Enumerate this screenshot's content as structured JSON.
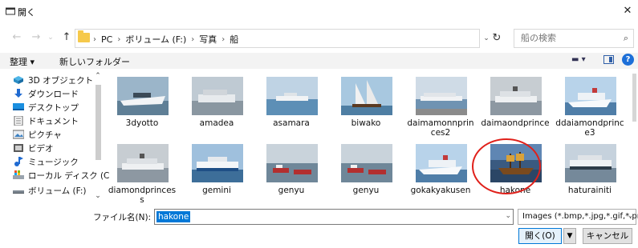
{
  "window": {
    "title": "開く"
  },
  "address": {
    "crumbs": [
      "PC",
      "ボリューム (F:)",
      "写真",
      "船"
    ]
  },
  "search": {
    "placeholder": "船の検索"
  },
  "commands": {
    "organize": "整理 ▾",
    "new_folder": "新しいフォルダー"
  },
  "nav": {
    "items": [
      {
        "label": "3D オブジェクト",
        "icon": "3d-objects-icon"
      },
      {
        "label": "ダウンロード",
        "icon": "download-icon"
      },
      {
        "label": "デスクトップ",
        "icon": "desktop-icon"
      },
      {
        "label": "ドキュメント",
        "icon": "document-icon"
      },
      {
        "label": "ピクチャ",
        "icon": "pictures-icon"
      },
      {
        "label": "ビデオ",
        "icon": "video-icon"
      },
      {
        "label": "ミュージック",
        "icon": "music-icon"
      },
      {
        "label": "ローカル ディスク (C",
        "icon": "local-disk-icon"
      },
      {
        "label": "ボリューム (F:)",
        "icon": "drive-icon"
      }
    ]
  },
  "files": [
    {
      "name": "3dyotto",
      "theme": "yacht"
    },
    {
      "name": "amadea",
      "theme": "harbor"
    },
    {
      "name": "asamara",
      "theme": "sea"
    },
    {
      "name": "biwako",
      "theme": "sailship"
    },
    {
      "name": "daimamonnprinces2",
      "theme": "port"
    },
    {
      "name": "daimaondprince",
      "theme": "liner-gray"
    },
    {
      "name": "ddaiamondprince3",
      "theme": "liner-white"
    },
    {
      "name": "diamondprincess",
      "theme": "liner-gray"
    },
    {
      "name": "gemini",
      "theme": "liner-blue"
    },
    {
      "name": "genyu",
      "theme": "tugs"
    },
    {
      "name": "genyu",
      "theme": "tugs"
    },
    {
      "name": "gokakyakusen",
      "theme": "liner-white"
    },
    {
      "name": "hakone",
      "theme": "pirate"
    },
    {
      "name": "haturainiti",
      "theme": "liner-dark"
    }
  ],
  "dialog": {
    "filename_label": "ファイル名(N):",
    "filename_value": "hakone",
    "filetype": "Images (*.bmp,*.jpg,*.gif,*.png)",
    "open_button": "開く(O)",
    "cancel_button": "キャンセル"
  },
  "highlight": {
    "file": "hakone",
    "color": "#e0201a"
  },
  "colors": {
    "selection": "#0078d7",
    "folder": "#f6c94b",
    "help": "#1d6fd8"
  }
}
